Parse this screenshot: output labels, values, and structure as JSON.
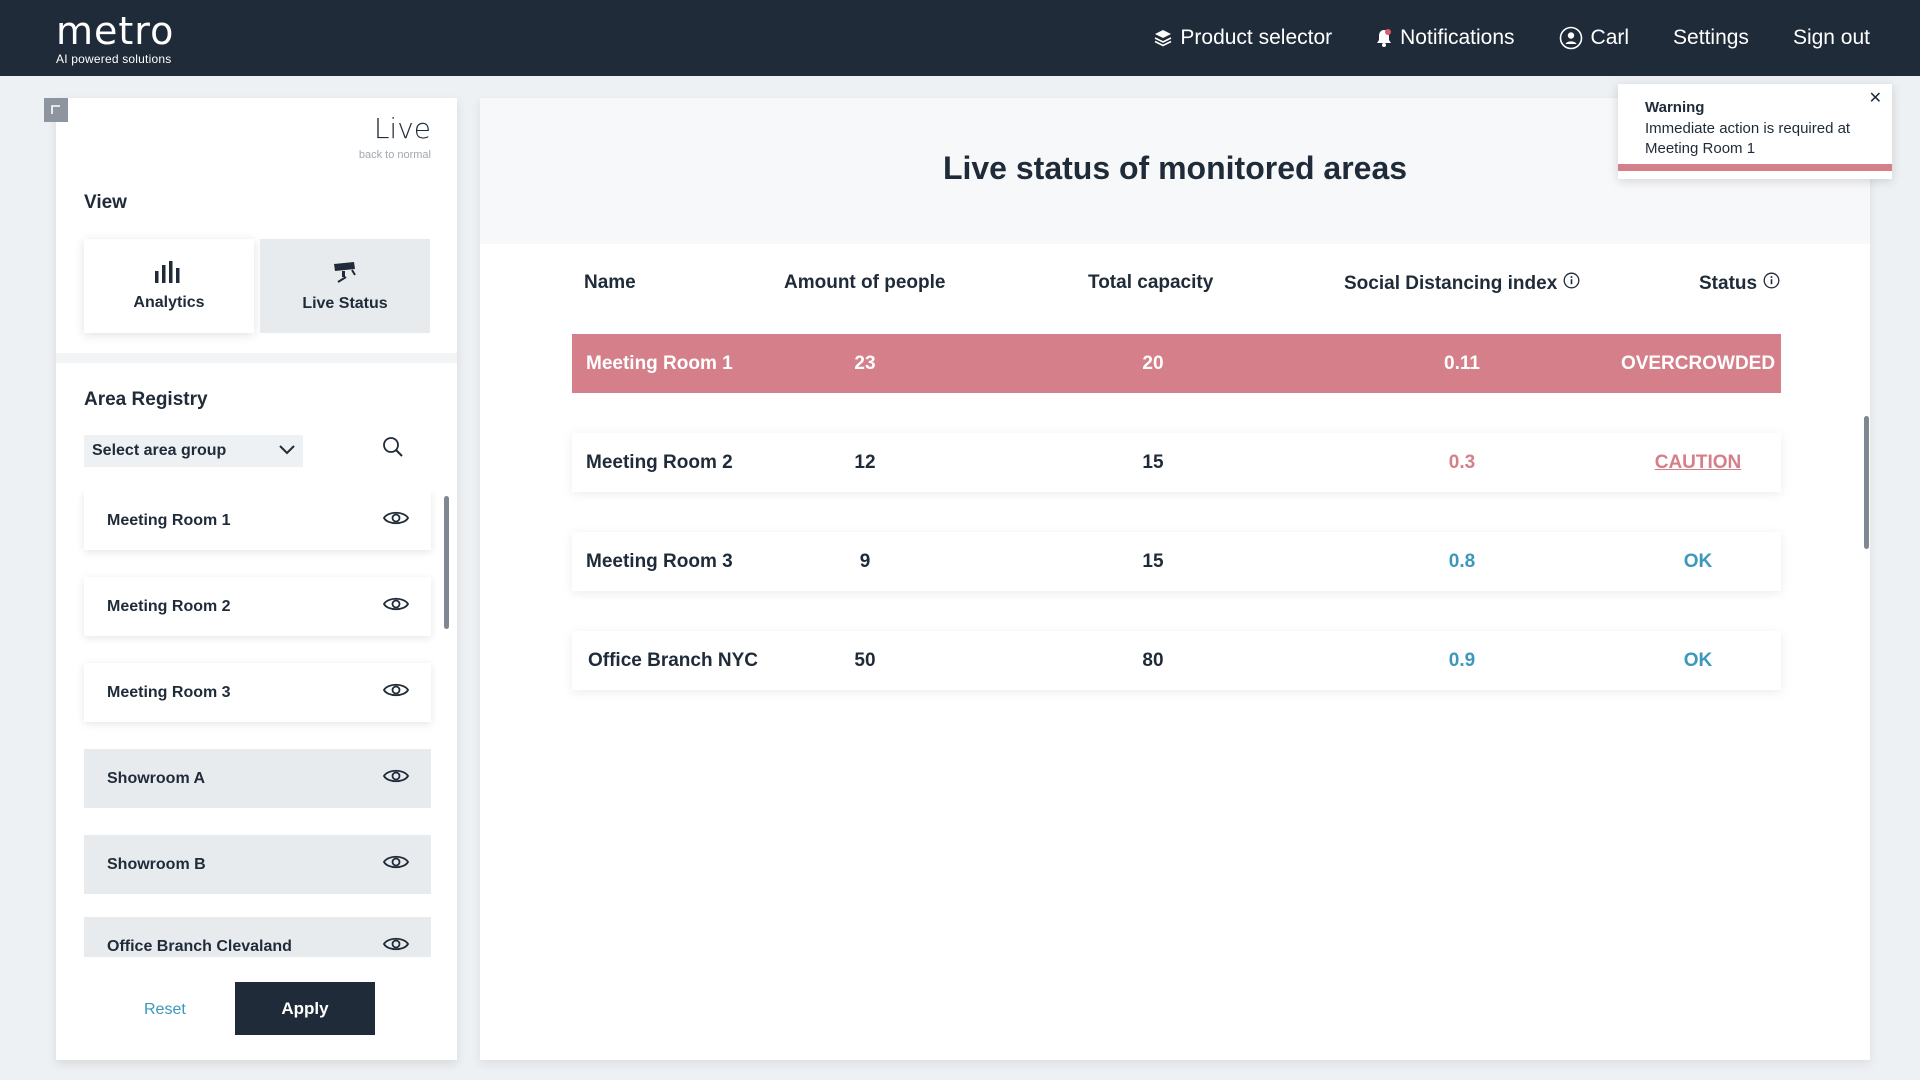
{
  "colors": {
    "navy": "#1f2b38",
    "alert": "#d47f89",
    "ok": "#3b97bc",
    "caution": "#d47f89"
  },
  "header": {
    "logo_word": "metro",
    "logo_tagline": "AI powered solutions",
    "nav": {
      "product_selector": "Product selector",
      "notifications": "Notifications",
      "user": "Carl",
      "settings": "Settings",
      "sign_out": "Sign out"
    }
  },
  "sidebar": {
    "mode_title": "Live",
    "mode_subtitle": "back to normal",
    "view_label": "View",
    "views": {
      "analytics": "Analytics",
      "live_status": "Live Status"
    },
    "area_registry_label": "Area Registry",
    "area_group_select": "Select area group",
    "areas": [
      {
        "label": "Meeting Room 1"
      },
      {
        "label": "Meeting Room 2"
      },
      {
        "label": "Meeting Room 3"
      },
      {
        "label": "Showroom A"
      },
      {
        "label": "Showroom B"
      },
      {
        "label": "Office Branch Clevaland"
      }
    ],
    "reset_label": "Reset",
    "apply_label": "Apply"
  },
  "main": {
    "title": "Live status of monitored areas",
    "columns": {
      "name": "Name",
      "people": "Amount of people",
      "capacity": "Total capacity",
      "sdi": "Social Distancing index",
      "status": "Status"
    },
    "rows": [
      {
        "name": "Meeting Room 1",
        "people": "23",
        "capacity": "20",
        "sdi": "0.11",
        "status": "OVERCROWDED"
      },
      {
        "name": "Meeting Room 2",
        "people": "12",
        "capacity": "15",
        "sdi": "0.3",
        "status": "CAUTION"
      },
      {
        "name": "Meeting Room 3",
        "people": "9",
        "capacity": "15",
        "sdi": "0.8",
        "status": "OK"
      },
      {
        "name": "Office Branch NYC",
        "people": "50",
        "capacity": "80",
        "sdi": "0.9",
        "status": "OK"
      }
    ]
  },
  "toast": {
    "title": "Warning",
    "message": "Immediate action is required at Meeting Room 1"
  }
}
